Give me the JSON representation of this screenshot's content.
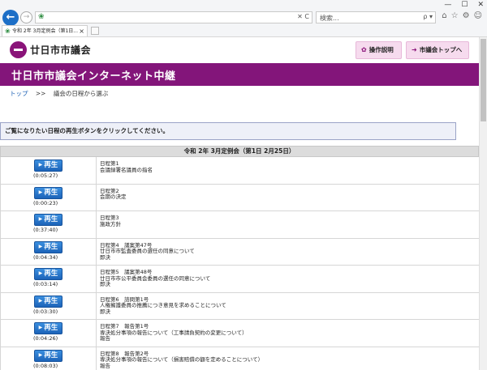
{
  "browser": {
    "window_controls": [
      "—",
      "☐",
      "✕"
    ],
    "address_text": "",
    "address_controls": "✕ C",
    "search_placeholder": "検索...",
    "search_controls": "ρ ▾",
    "tab_title": "令和 2年 3月定例会（第1日...",
    "tab_close": "×",
    "toolbar_icons": [
      "⌂",
      "☆",
      "⚙",
      "☺"
    ]
  },
  "header": {
    "site_name": "廿日市市議会",
    "help_button": "操作説明",
    "top_button": "市議会トップへ"
  },
  "banner": {
    "title": "廿日市市議会インターネット中継"
  },
  "breadcrumb": {
    "home": "トップ",
    "separator": ">>",
    "current": "議会の日程から選ぶ"
  },
  "notice": "ご覧になりたい日程の再生ボタンをクリックしてください。",
  "session_heading": "令和 2年 3月定例会（第1日 2月25日）",
  "play_label": "再生",
  "items": [
    {
      "duration": "(0:05:27)",
      "lines": [
        "日程第1",
        "会議録署名議員の指名"
      ]
    },
    {
      "duration": "(0:00:23)",
      "lines": [
        "日程第2",
        "会期の決定"
      ]
    },
    {
      "duration": "(0:37:40)",
      "lines": [
        "日程第3",
        "施政方針"
      ]
    },
    {
      "duration": "(0:04:34)",
      "lines": [
        "日程第4　議案第47号",
        "廿日市市監査委員の選任の同意について",
        "即決"
      ]
    },
    {
      "duration": "(0:03:14)",
      "lines": [
        "日程第5　議案第48号",
        "廿日市市公平委員会委員の選任の同意について",
        "即決"
      ]
    },
    {
      "duration": "(0:03:30)",
      "lines": [
        "日程第6　諮問第1号",
        "人権擁護委員の推薦につき意見を求めることについて",
        "即決"
      ]
    },
    {
      "duration": "(0:04:26)",
      "lines": [
        "日程第7　報告第1号",
        "専決処分事項の報告について（工事請負契約の変更について）",
        "報告"
      ]
    },
    {
      "duration": "(0:08:03)",
      "lines": [
        "日程第8　報告第2号",
        "専決処分事項の報告について（損害賠償の額を定めることについて）",
        "報告"
      ]
    }
  ]
}
